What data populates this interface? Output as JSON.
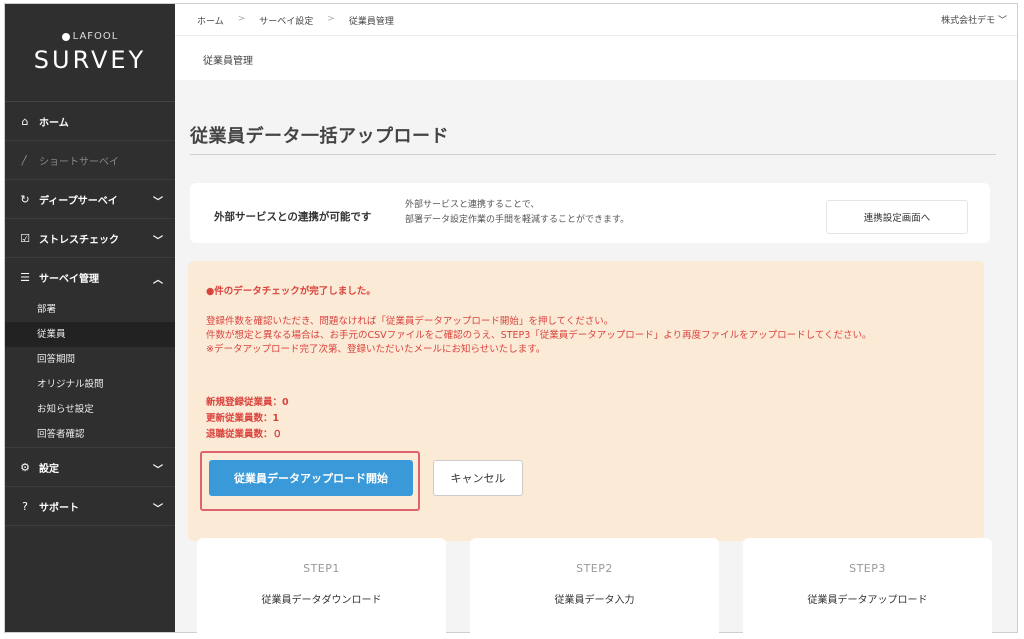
{
  "brand": {
    "name": "LAFOOL",
    "title": "SURVEY"
  },
  "sidebar": {
    "home": "ホーム",
    "short_survey": "ショートサーベイ",
    "deep_survey": "ディープサーベイ",
    "stress_check": "ストレスチェック",
    "survey_admin": "サーベイ管理",
    "sub_items": [
      "部署",
      "従業員",
      "回答期間",
      "オリジナル設問",
      "お知らせ設定",
      "回答者確認"
    ],
    "settings": "設定",
    "support": "サポート"
  },
  "topbar": {
    "breadcrumbs": [
      "ホーム",
      "サーベイ設定",
      "従業員管理"
    ],
    "company": "株式会社デモ"
  },
  "subheader": {
    "title": "従業員管理"
  },
  "page": {
    "title": "従業員データ一括アップロード"
  },
  "external": {
    "label": "外部サービスとの連携が可能です",
    "desc_line1": "外部サービスと連携することで、",
    "desc_line2": "部署データ設定作業の手間を軽減することができます。",
    "button": "連携設定画面へ"
  },
  "notice": {
    "headline": "●件のデータチェックが完了しました。",
    "line1": "登録件数を確認いただき、問題なければ「従業員データアップロード開始」を押してください。",
    "line2": "件数が想定と異なる場合は、お手元のCSVファイルをご確認のうえ、STEP3「従業員データアップロード」より再度ファイルをアップロードしてください。",
    "line3": "※データアップロード完了次第、登録いただいたメールにお知らせいたします。",
    "new_count": "新規登録従業員：0",
    "update_count": "更新従業員数：1",
    "retire_count": "退職従業員数：０",
    "start_button": "従業員データアップロード開始",
    "cancel_button": "キャンセル"
  },
  "steps": [
    {
      "label": "STEP1",
      "name": "従業員データダウンロード"
    },
    {
      "label": "STEP2",
      "name": "従業員データ入力"
    },
    {
      "label": "STEP3",
      "name": "従業員データアップロード"
    }
  ]
}
